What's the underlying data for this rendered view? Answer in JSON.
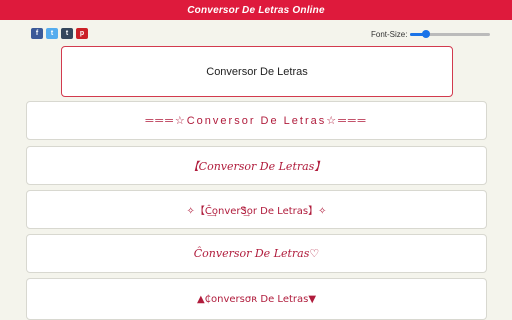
{
  "header": {
    "title": "Conversor De Letras Online",
    "bg_color": "#de1a3c"
  },
  "share": [
    {
      "icon": "facebook-icon",
      "glyph": "f",
      "color": "#3b5998"
    },
    {
      "icon": "twitter-icon",
      "glyph": "t",
      "color": "#55acee"
    },
    {
      "icon": "tumblr-icon",
      "glyph": "t",
      "color": "#35465c"
    },
    {
      "icon": "pinterest-icon",
      "glyph": "p",
      "color": "#cb2027"
    }
  ],
  "font_size": {
    "label": "Font-Size:",
    "value_fraction": 0.2
  },
  "input": {
    "value": "Conversor De Letras"
  },
  "results": [
    "═══☆Conversor De Letras☆═══",
    "【Conversor De Letras】",
    "✧【Ĉ͢onverᏕ͢or De Letras】✧",
    "Ĉonversor De Letras♡",
    "▲₵onversσʀ De Letras▼"
  ]
}
